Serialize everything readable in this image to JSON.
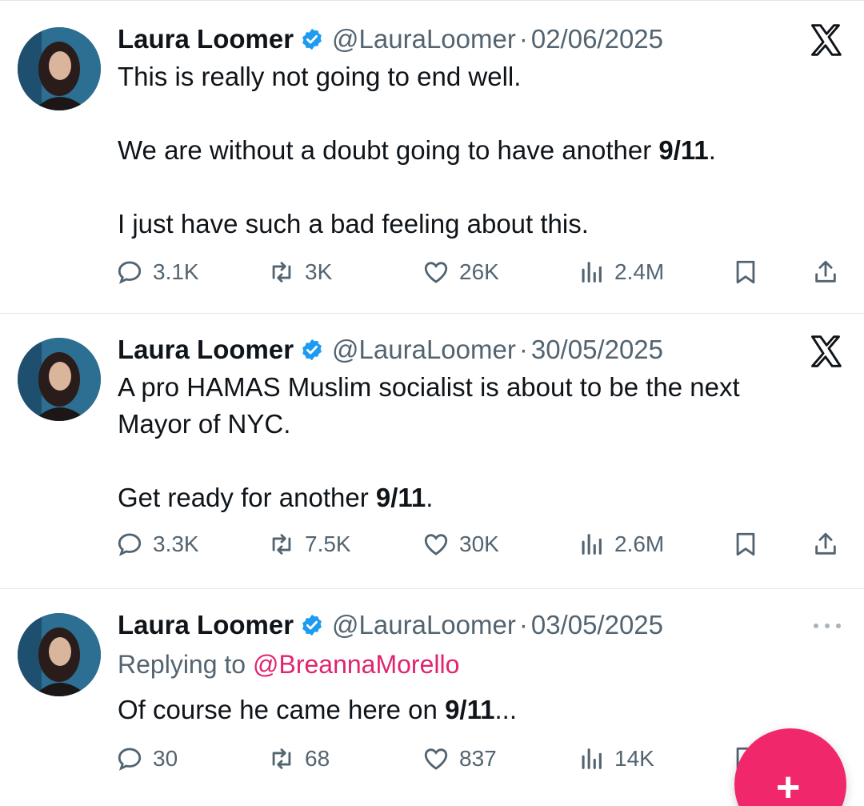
{
  "tweets": [
    {
      "name": "Laura Loomer",
      "handle": "@LauraLoomer",
      "separator": "·",
      "date": "02/06/2025",
      "replying_label": "",
      "replying_to": "",
      "paragraphs": [
        [
          {
            "t": "This is really not going to end well.",
            "b": false
          }
        ],
        [],
        [
          {
            "t": "We are without a doubt going to have another ",
            "b": false
          },
          {
            "t": "9/11",
            "b": true
          },
          {
            "t": ".",
            "b": false
          }
        ],
        [],
        [
          {
            "t": "I just have such a bad feeling about this.",
            "b": false
          }
        ]
      ],
      "stats": {
        "replies": "3.1K",
        "reposts": "3K",
        "likes": "26K",
        "views": "2.4M"
      },
      "corner_icon": "x-logo-icon"
    },
    {
      "name": "Laura Loomer",
      "handle": "@LauraLoomer",
      "separator": "·",
      "date": "30/05/2025",
      "replying_label": "",
      "replying_to": "",
      "paragraphs": [
        [
          {
            "t": "A pro HAMAS Muslim socialist is about to be the next Mayor of NYC.",
            "b": false
          }
        ],
        [],
        [
          {
            "t": "Get ready for another ",
            "b": false
          },
          {
            "t": "9/11",
            "b": true
          },
          {
            "t": ".",
            "b": false
          }
        ]
      ],
      "stats": {
        "replies": "3.3K",
        "reposts": "7.5K",
        "likes": "30K",
        "views": "2.6M"
      },
      "corner_icon": "x-logo-icon"
    },
    {
      "name": "Laura Loomer",
      "handle": "@LauraLoomer",
      "separator": "·",
      "date": "03/05/2025",
      "replying_label": "Replying to ",
      "replying_to": "@BreannaMorello",
      "paragraphs": [
        [
          {
            "t": "Of course he came here on ",
            "b": false
          },
          {
            "t": "9/11",
            "b": true
          },
          {
            "t": "...",
            "b": false
          }
        ]
      ],
      "stats": {
        "replies": "30",
        "reposts": "68",
        "likes": "837",
        "views": "14K"
      },
      "corner_icon": "more-icon"
    }
  ],
  "fab": {
    "label": "+",
    "color": "#f0286b"
  },
  "colors": {
    "text": "#0f1419",
    "secondary": "#536471",
    "verified": "#1d9bf0",
    "mention": "#e0246f",
    "divider": "#e3e6e9"
  },
  "icons": {
    "reply": "reply-icon",
    "repost": "repost-icon",
    "like": "heart-icon",
    "views": "views-icon",
    "bookmark": "bookmark-icon",
    "share": "share-icon",
    "verified": "verified-badge-icon"
  }
}
